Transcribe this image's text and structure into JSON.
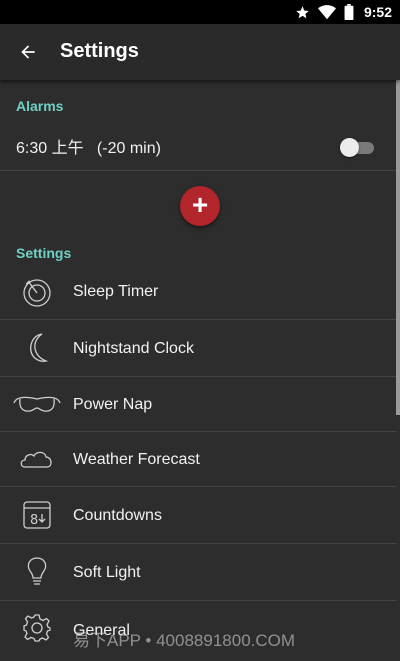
{
  "status_bar": {
    "time": "9:52",
    "icons": [
      "star-icon",
      "wifi-icon",
      "battery-icon"
    ]
  },
  "app_bar": {
    "title": "Settings",
    "back_icon": "arrow-left-icon"
  },
  "alarms": {
    "header": "Alarms",
    "items": [
      {
        "text": "6:30 上午   (-20 min)",
        "enabled": false
      }
    ]
  },
  "add_button": {
    "label": "+"
  },
  "settings": {
    "header": "Settings",
    "items": [
      {
        "label": "Sleep Timer",
        "icon": "sleep-timer-icon"
      },
      {
        "label": "Nightstand Clock",
        "icon": "moon-icon"
      },
      {
        "label": "Power Nap",
        "icon": "sleep-mask-icon"
      },
      {
        "label": "Weather Forecast",
        "icon": "cloud-icon"
      },
      {
        "label": "Countdowns",
        "icon": "calendar-countdown-icon"
      },
      {
        "label": "Soft Light",
        "icon": "lightbulb-icon"
      },
      {
        "label": "General",
        "icon": "gear-icon"
      }
    ]
  },
  "watermark": "易下APP • 4008891800.COM",
  "colors": {
    "accent": "#6fd1c5",
    "fab": "#b2252b",
    "background": "#2d2d2d"
  }
}
